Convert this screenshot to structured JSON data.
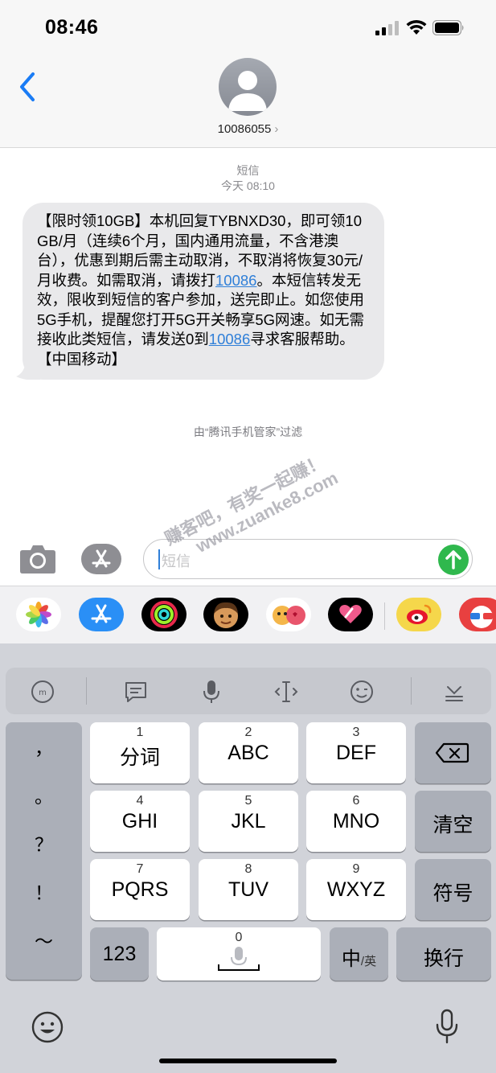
{
  "status_bar": {
    "time": "08:46"
  },
  "header": {
    "contact": "10086055",
    "chevron": "›"
  },
  "thread": {
    "service": "短信",
    "timestamp": "今天 08:10",
    "message": {
      "part1": "【限时领10GB】本机回复TYBNXD30，即可领10GB/月（连续6个月，国内通用流量，不含港澳台），优惠到期后需主动取消，不取消将恢复30元/月收费。如需取消，请拨打",
      "link1": "10086",
      "part2": "。本短信转发无效，限收到短信的客户参加，送完即止。如您使用5G手机，提醒您打开5G开关畅享5G网速。如无需接收此类短信，请发送0到",
      "link2": "10086",
      "part3": "寻求客服帮助。【中国移动】"
    },
    "filter_note": "由“腾讯手机管家”过滤"
  },
  "watermark": {
    "line1": "赚客吧，有奖一起赚！",
    "line2": "www.zuanke8.com"
  },
  "input": {
    "placeholder": "短信"
  },
  "apps": [
    "photos-icon",
    "appstore-icon",
    "activity-icon",
    "memoji-icon",
    "animoji-icon",
    "digital-touch-icon",
    "weibo-icon",
    "glasses-app-icon"
  ],
  "keyboard": {
    "punctuation": [
      "，",
      "。",
      "？",
      "！",
      "～"
    ],
    "keys": [
      {
        "num": "1",
        "label": "分词"
      },
      {
        "num": "2",
        "label": "ABC"
      },
      {
        "num": "3",
        "label": "DEF"
      },
      {
        "num": "4",
        "label": "GHI"
      },
      {
        "num": "5",
        "label": "JKL"
      },
      {
        "num": "6",
        "label": "MNO"
      },
      {
        "num": "7",
        "label": "PQRS"
      },
      {
        "num": "8",
        "label": "TUV"
      },
      {
        "num": "9",
        "label": "WXYZ"
      }
    ],
    "space_num": "0",
    "clear": "清空",
    "symbols": "符号",
    "numbers": "123",
    "lang_main": "中",
    "lang_sub": "/英",
    "return": "换行"
  },
  "colors": {
    "link": "#2f7fd8",
    "send": "#2fb84d",
    "bubble": "#e9e9eb"
  }
}
